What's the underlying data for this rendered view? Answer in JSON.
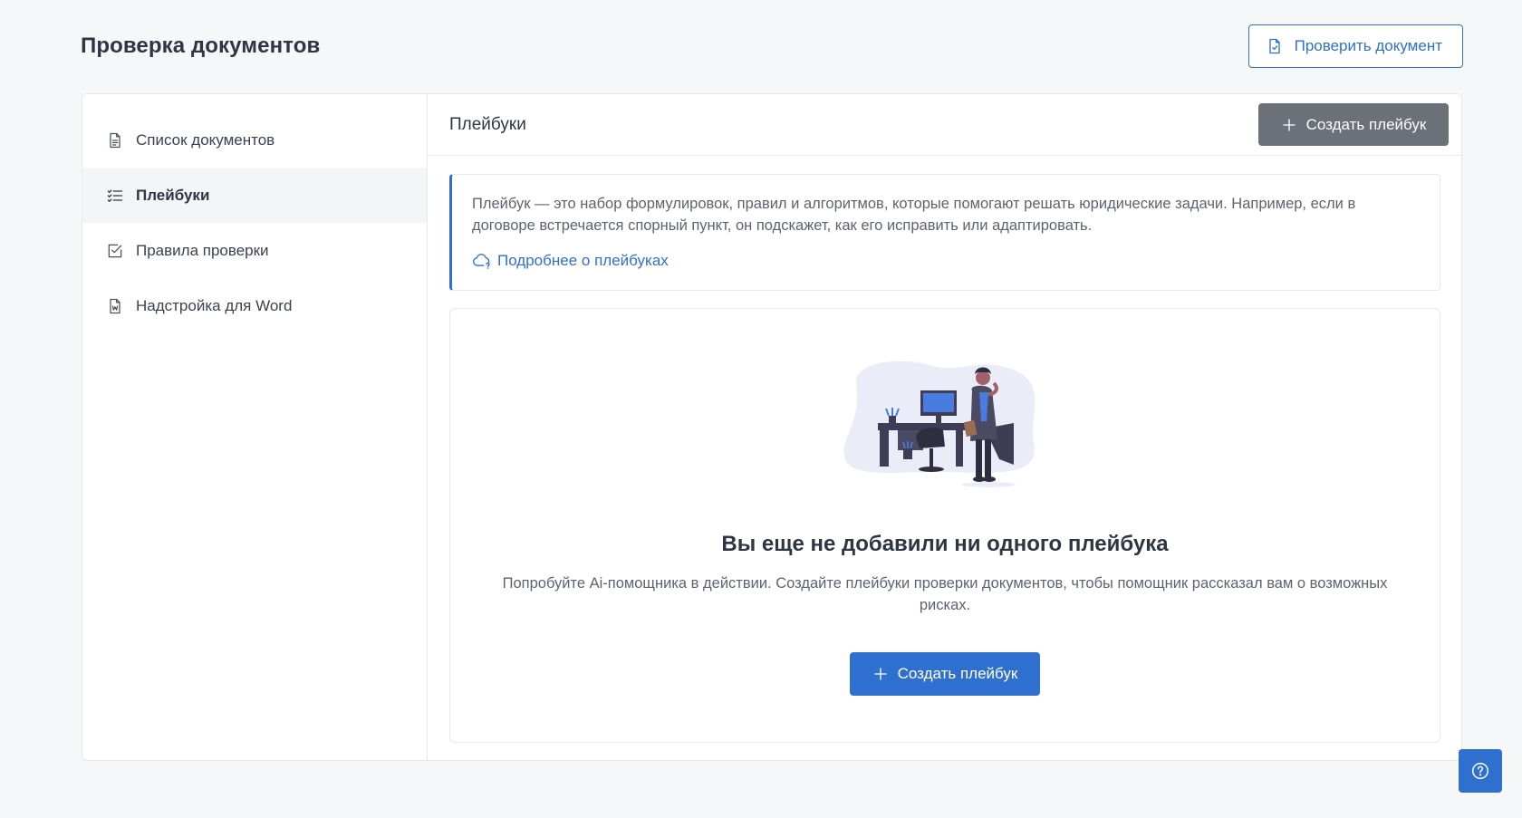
{
  "header": {
    "title": "Проверка документов",
    "check_button": "Проверить документ"
  },
  "sidebar": {
    "items": [
      {
        "label": "Список документов",
        "icon": "document-icon",
        "active": false
      },
      {
        "label": "Плейбуки",
        "icon": "checklist-icon",
        "active": true
      },
      {
        "label": "Правила проверки",
        "icon": "checkbox-icon",
        "active": false
      },
      {
        "label": "Надстройка для Word",
        "icon": "word-file-icon",
        "active": false
      }
    ]
  },
  "main": {
    "title": "Плейбуки",
    "create_button": "Создать плейбук",
    "info": {
      "text": "Плейбук — это набор формулировок, правил и алгоритмов, которые помогают решать юридические задачи. Например, если в договоре встречается спорный пункт, он подскажет, как его исправить или адаптировать.",
      "link": "Подробнее о плейбуках"
    },
    "empty": {
      "title": "Вы еще не добавили ни одного плейбука",
      "description": "Попробуйте Ai-помощника в действии. Создайте плейбуки проверки документов, чтобы помощник рассказал вам о возможных рисках.",
      "button": "Создать плейбук"
    }
  },
  "colors": {
    "primary": "#2f6fd0",
    "gray_button": "#6b7079",
    "background": "#f6f7f9"
  }
}
